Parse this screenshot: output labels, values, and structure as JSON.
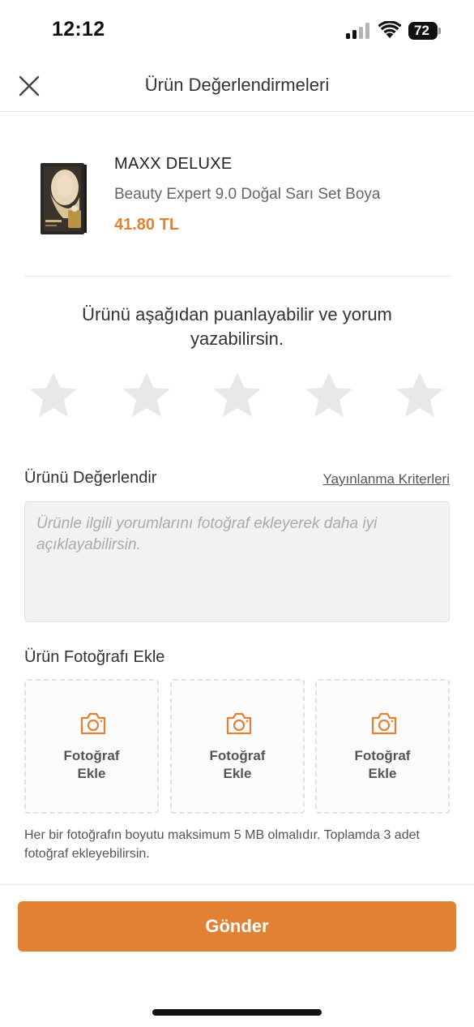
{
  "status_bar": {
    "time": "12:12",
    "battery": "72",
    "icons": [
      "signal-icon",
      "wifi-icon",
      "battery-icon"
    ]
  },
  "header": {
    "title": "Ürün Değerlendirmeleri",
    "close_icon": "close-icon"
  },
  "product": {
    "brand": "MAXX DELUXE",
    "name": "Beauty Expert 9.0 Doğal Sarı Set Boya",
    "price": "41.80 TL"
  },
  "rating": {
    "prompt": "Ürünü aşağıdan puanlayabilir ve yorum yazabilirsin.",
    "max_stars": 5,
    "selected": 0,
    "star_color": "#e8e8e8"
  },
  "review": {
    "title": "Ürünü Değerlendir",
    "criteria_link": "Yayınlanma Kriterleri",
    "placeholder": "Ürünle ilgili yorumlarını fotoğraf ekleyerek daha iyi açıklayabilirsin.",
    "value": ""
  },
  "photos": {
    "title": "Ürün Fotoğrafı Ekle",
    "slots": [
      {
        "line1": "Fotoğraf",
        "line2": "Ekle"
      },
      {
        "line1": "Fotoğraf",
        "line2": "Ekle"
      },
      {
        "line1": "Fotoğraf",
        "line2": "Ekle"
      }
    ],
    "note": "Her bir fotoğrafın boyutu maksimum 5 MB olmalıdır. Toplamda 3 adet fotoğraf ekleyebilirsin."
  },
  "submit_label": "Gönder",
  "colors": {
    "accent": "#e08134",
    "text": "#333333",
    "muted": "#aaaaaa"
  }
}
